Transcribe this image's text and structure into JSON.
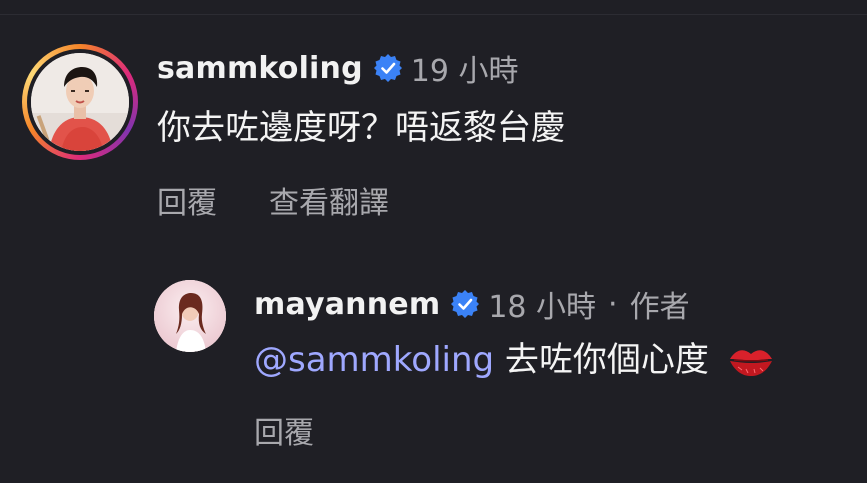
{
  "comments": [
    {
      "username": "sammkoling",
      "time": "19 小時",
      "text": "你去咗邊度呀？唔返黎台慶",
      "actions": [
        "回覆",
        "查看翻譯"
      ],
      "avatar_ring": true
    },
    {
      "username": "mayannem",
      "time": "18 小時",
      "separator": "·",
      "author_label": "作者",
      "mention": "@sammkoling",
      "text": "去咗你個心度",
      "emoji": "kiss-mark-icon",
      "actions": [
        "回覆"
      ]
    }
  ],
  "colors": {
    "background": "#1f1f25",
    "verified": "#3b82f6",
    "mention": "#9fa8ff",
    "muted": "#a8a8ad"
  }
}
